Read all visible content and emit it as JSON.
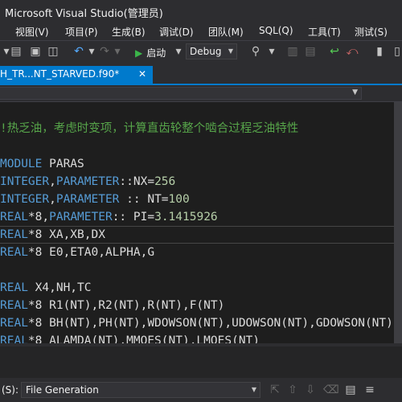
{
  "window": {
    "title": "Microsoft Visual Studio(管理员)"
  },
  "menu": [
    "视图(V)",
    "项目(P)",
    "生成(B)",
    "调试(D)",
    "团队(M)",
    "SQL(Q)",
    "工具(T)",
    "测试(S)"
  ],
  "toolbar": {
    "start_label": "启动",
    "configuration": "Debug"
  },
  "tab": {
    "name": "H_TR...NT_STARVED.f90*",
    "close": "✕"
  },
  "editor": {
    "lines": [
      [
        {
          "t": "",
          "c": ""
        }
      ],
      [
        {
          "t": "!热乏油，考虑时变项，计算直齿轮整个啮合过程乏油特性",
          "c": "cm"
        }
      ],
      [
        {
          "t": "",
          "c": ""
        }
      ],
      [
        {
          "t": "MODULE",
          "c": "kw"
        },
        {
          "t": " PARAS",
          "c": ""
        }
      ],
      [
        {
          "t": "INTEGER",
          "c": "kw"
        },
        {
          "t": ",",
          "c": ""
        },
        {
          "t": "PARAMETER",
          "c": "kw"
        },
        {
          "t": "::NX=",
          "c": ""
        },
        {
          "t": "256",
          "c": "num"
        }
      ],
      [
        {
          "t": "INTEGER",
          "c": "kw"
        },
        {
          "t": ",",
          "c": ""
        },
        {
          "t": "PARAMETER",
          "c": "kw"
        },
        {
          "t": " :: NT=",
          "c": ""
        },
        {
          "t": "100",
          "c": "num"
        }
      ],
      [
        {
          "t": "REAL",
          "c": "kw"
        },
        {
          "t": "*8,",
          "c": ""
        },
        {
          "t": "PARAMETER",
          "c": "kw"
        },
        {
          "t": ":: PI=",
          "c": ""
        },
        {
          "t": "3.1415926",
          "c": "num"
        }
      ],
      [
        {
          "t": "REAL",
          "c": "kw"
        },
        {
          "t": "*8 XA,XB,DX",
          "c": ""
        }
      ],
      [
        {
          "t": "REAL",
          "c": "kw"
        },
        {
          "t": "*8 E0,ETA0,ALPHA,G",
          "c": ""
        }
      ],
      [
        {
          "t": "",
          "c": ""
        }
      ],
      [
        {
          "t": "REAL",
          "c": "kw"
        },
        {
          "t": " X4,NH,TC",
          "c": ""
        }
      ],
      [
        {
          "t": "REAL",
          "c": "kw"
        },
        {
          "t": "*8 R1(NT),R2(NT),R(NT),F(NT)",
          "c": ""
        }
      ],
      [
        {
          "t": "REAL",
          "c": "kw"
        },
        {
          "t": "*8 BH(NT),PH(NT),WDOWSON(NT),UDOWSON(NT),GDOWSON(NT)",
          "c": ""
        }
      ],
      [
        {
          "t": "REAL",
          "c": "kw"
        },
        {
          "t": "*8 ALAMDA(NT),MMOES(NT),LMOES(NT)",
          "c": ""
        }
      ]
    ]
  },
  "output": {
    "label": "(S):",
    "source": "File Generation"
  }
}
